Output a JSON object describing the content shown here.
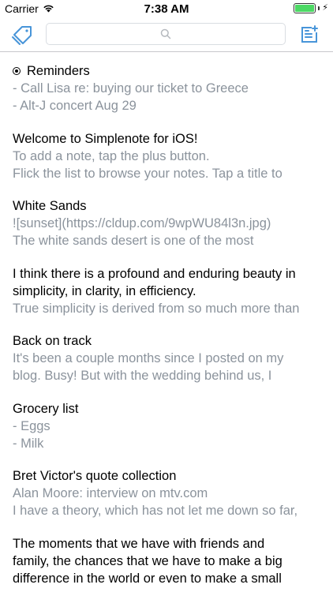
{
  "status_bar": {
    "carrier": "Carrier",
    "time": "7:38 AM",
    "battery_level": 1.0,
    "charging": true
  },
  "nav": {
    "search_placeholder": "",
    "icons": {
      "tags": "tag-icon",
      "search": "search-icon",
      "new_note": "new-note-icon"
    },
    "accent_color": "#4895d9"
  },
  "notes": [
    {
      "title": "Reminders",
      "pinned": true,
      "lines": [
        "- Call Lisa re: buying our ticket to Greece",
        "- Alt-J concert Aug 29"
      ]
    },
    {
      "title": "Welcome to Simplenote for iOS!",
      "pinned": false,
      "lines": [
        "To add a note, tap the plus button.",
        "Flick the list to browse your notes. Tap a title to"
      ]
    },
    {
      "title": "White Sands",
      "pinned": false,
      "lines": [
        "![sunset](https://cldup.com/9wpWU84l3n.jpg)",
        "The white sands desert is one of the most"
      ]
    },
    {
      "title_lines": [
        "I think there is a profound and enduring beauty in",
        "simplicity, in clarity, in efficiency."
      ],
      "pinned": false,
      "lines": [
        "True simplicity is derived from so much more than"
      ]
    },
    {
      "title": "Back on track",
      "pinned": false,
      "lines": [
        "It's been a couple months since I posted on my",
        "blog. Busy! But with the wedding behind us, I"
      ]
    },
    {
      "title": "Grocery list",
      "pinned": false,
      "lines": [
        "- Eggs",
        "- Milk"
      ]
    },
    {
      "title": "Bret Victor's quote collection",
      "pinned": false,
      "lines": [
        "Alan Moore: interview on mtv.com",
        "I have a theory, which has not let me down so far,"
      ]
    },
    {
      "title_lines": [
        "The moments that we have with friends and",
        "family, the chances that we have to make a big",
        "difference in the world or even to make a small"
      ],
      "pinned": false,
      "lines": []
    }
  ]
}
